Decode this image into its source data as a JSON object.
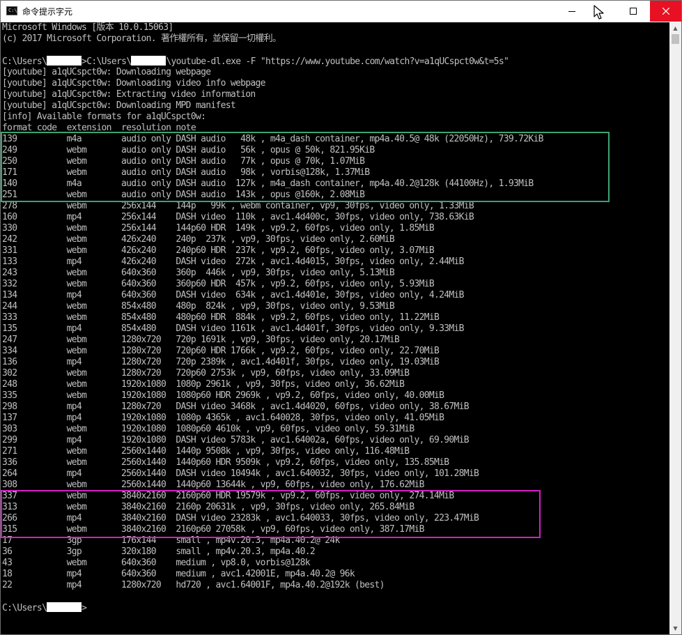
{
  "window": {
    "title": "命令提示字元",
    "icon_label": "C:\\",
    "icon": "console-app-icon",
    "controls": {
      "minimize": "minimize-icon",
      "maximize": "maximize-icon",
      "close": "close-icon"
    }
  },
  "colors": {
    "console_bg": "#000000",
    "console_text": "#c0c0c0",
    "audio_highlight": "#3aa673",
    "uhd_highlight": "#d31fc8",
    "close_button": "#e81123"
  },
  "console": {
    "lines": [
      "Microsoft Windows [版本 10.0.15063]",
      "(c) 2017 Microsoft Corporation. 著作權所有，並保留一切權利。",
      "",
      "[[prompt_cmd]]",
      "[youtube] a1qUCspct0w: Downloading webpage",
      "[youtube] a1qUCspct0w: Downloading video info webpage",
      "[youtube] a1qUCspct0w: Extracting video information",
      "[youtube] a1qUCspct0w: Downloading MPD manifest",
      "[info] Available formats for a1qUCspct0w:",
      "format code  extension  resolution note",
      "139          m4a        audio only DASH audio   48k , m4a_dash container, mp4a.40.5@ 48k (22050Hz), 739.72KiB",
      "249          webm       audio only DASH audio   56k , opus @ 50k, 821.95KiB",
      "250          webm       audio only DASH audio   77k , opus @ 70k, 1.07MiB",
      "171          webm       audio only DASH audio   98k , vorbis@128k, 1.37MiB",
      "140          m4a        audio only DASH audio  127k , m4a_dash container, mp4a.40.2@128k (44100Hz), 1.93MiB",
      "251          webm       audio only DASH audio  143k , opus @160k, 2.08MiB",
      "278          webm       256x144    144p   99k , webm container, vp9, 30fps, video only, 1.33MiB",
      "160          mp4        256x144    DASH video  110k , avc1.4d400c, 30fps, video only, 738.63KiB",
      "330          webm       256x144    144p60 HDR  149k , vp9.2, 60fps, video only, 1.85MiB",
      "242          webm       426x240    240p  237k , vp9, 30fps, video only, 2.60MiB",
      "331          webm       426x240    240p60 HDR  237k , vp9.2, 60fps, video only, 3.07MiB",
      "133          mp4        426x240    DASH video  272k , avc1.4d4015, 30fps, video only, 2.44MiB",
      "243          webm       640x360    360p  446k , vp9, 30fps, video only, 5.13MiB",
      "332          webm       640x360    360p60 HDR  457k , vp9.2, 60fps, video only, 5.93MiB",
      "134          mp4        640x360    DASH video  634k , avc1.4d401e, 30fps, video only, 4.24MiB",
      "244          webm       854x480    480p  824k , vp9, 30fps, video only, 9.53MiB",
      "333          webm       854x480    480p60 HDR  884k , vp9.2, 60fps, video only, 11.22MiB",
      "135          mp4        854x480    DASH video 1161k , avc1.4d401f, 30fps, video only, 9.33MiB",
      "247          webm       1280x720   720p 1691k , vp9, 30fps, video only, 20.17MiB",
      "334          webm       1280x720   720p60 HDR 1766k , vp9.2, 60fps, video only, 22.70MiB",
      "136          mp4        1280x720   720p 2389k , avc1.4d401f, 30fps, video only, 19.03MiB",
      "302          webm       1280x720   720p60 2753k , vp9, 60fps, video only, 33.09MiB",
      "248          webm       1920x1080  1080p 2961k , vp9, 30fps, video only, 36.62MiB",
      "335          webm       1920x1080  1080p60 HDR 2969k , vp9.2, 60fps, video only, 40.00MiB",
      "298          mp4        1280x720   DASH video 3468k , avc1.4d4020, 60fps, video only, 38.67MiB",
      "137          mp4        1920x1080  1080p 4365k , avc1.640028, 30fps, video only, 41.05MiB",
      "303          webm       1920x1080  1080p60 4610k , vp9, 60fps, video only, 59.31MiB",
      "299          mp4        1920x1080  DASH video 5783k , avc1.64002a, 60fps, video only, 69.90MiB",
      "271          webm       2560x1440  1440p 9508k , vp9, 30fps, video only, 116.48MiB",
      "336          webm       2560x1440  1440p60 HDR 9509k , vp9.2, 60fps, video only, 135.85MiB",
      "264          mp4        2560x1440  DASH video 10494k , avc1.640032, 30fps, video only, 101.28MiB",
      "308          webm       2560x1440  1440p60 13644k , vp9, 60fps, video only, 176.62MiB",
      "337          webm       3840x2160  2160p60 HDR 19579k , vp9.2, 60fps, video only, 274.14MiB",
      "313          webm       3840x2160  2160p 20631k , vp9, 30fps, video only, 265.84MiB",
      "266          mp4        3840x2160  DASH video 23283k , avc1.640033, 30fps, video only, 223.47MiB",
      "315          webm       3840x2160  2160p60 27058k , vp9, 60fps, video only, 387.17MiB",
      "17           3gp        176x144    small , mp4v.20.3, mp4a.40.2@ 24k",
      "36           3gp        320x180    small , mp4v.20.3, mp4a.40.2",
      "43           webm       640x360    medium , vp8.0, vorbis@128k",
      "18           mp4        640x360    medium , avc1.42001E, mp4a.40.2@ 96k",
      "22           mp4        1280x720   hd720 , avc1.64001F, mp4a.40.2@192k (best)",
      "",
      "[[prompt_end]]"
    ],
    "prompt_cmd": {
      "before": "C:\\Users\\",
      "middle": ">C:\\Users\\",
      "after": "\\youtube-dl.exe -F \"https://www.youtube.com/watch?v=a1qUCspct0w&t=5s\""
    },
    "prompt_end": {
      "before": "C:\\Users\\",
      "after": ">"
    }
  }
}
